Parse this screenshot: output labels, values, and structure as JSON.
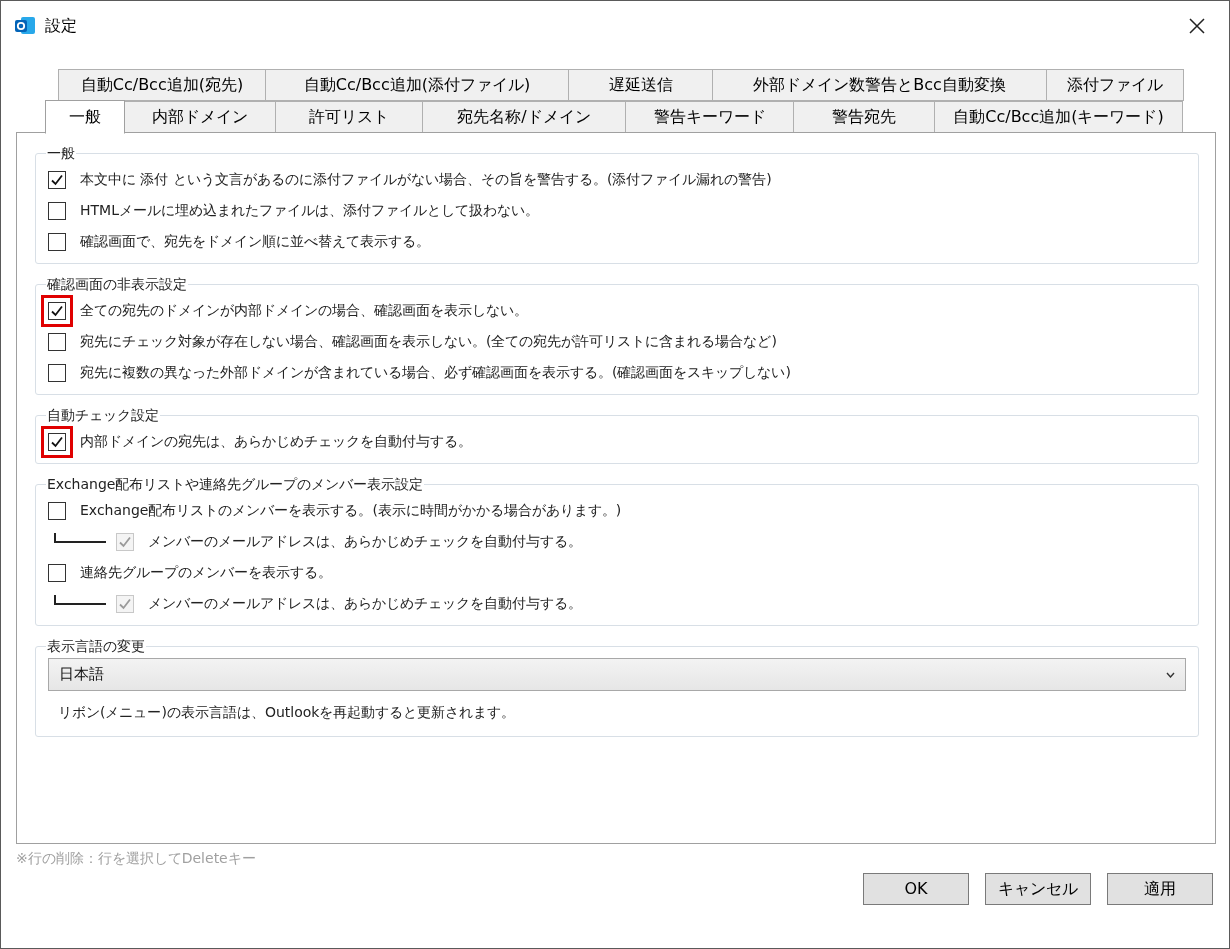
{
  "window": {
    "title": "設定"
  },
  "tab_rows": [
    {
      "tabs": [
        {
          "label": "自動Cc/Bcc追加(宛先)",
          "selected": false
        },
        {
          "label": "自動Cc/Bcc追加(添付ファイル)",
          "selected": false
        },
        {
          "label": "遅延送信",
          "selected": false
        },
        {
          "label": "外部ドメイン数警告とBcc自動変換",
          "selected": false
        },
        {
          "label": "添付ファイル",
          "selected": false
        }
      ]
    },
    {
      "tabs": [
        {
          "label": "一般",
          "selected": true
        },
        {
          "label": "内部ドメイン",
          "selected": false
        },
        {
          "label": "許可リスト",
          "selected": false
        },
        {
          "label": "宛先名称/ドメイン",
          "selected": false
        },
        {
          "label": "警告キーワード",
          "selected": false
        },
        {
          "label": "警告宛先",
          "selected": false
        },
        {
          "label": "自動Cc/Bcc追加(キーワード)",
          "selected": false
        }
      ]
    }
  ],
  "groups": [
    {
      "title": "一般",
      "options": [
        {
          "label": "本文中に 添付 という文言があるのに添付ファイルがない場合、その旨を警告する。(添付ファイル漏れの警告)",
          "checked": true,
          "highlighted": false
        },
        {
          "label": "HTMLメールに埋め込まれたファイルは、添付ファイルとして扱わない。",
          "checked": false,
          "highlighted": false
        },
        {
          "label": "確認画面で、宛先をドメイン順に並べ替えて表示する。",
          "checked": false,
          "highlighted": false
        }
      ]
    },
    {
      "title": "確認画面の非表示設定",
      "options": [
        {
          "label": "全ての宛先のドメインが内部ドメインの場合、確認画面を表示しない。",
          "checked": true,
          "highlighted": true
        },
        {
          "label": "宛先にチェック対象が存在しない場合、確認画面を表示しない。(全ての宛先が許可リストに含まれる場合など)",
          "checked": false,
          "highlighted": false
        },
        {
          "label": "宛先に複数の異なった外部ドメインが含まれている場合、必ず確認画面を表示する。(確認画面をスキップしない)",
          "checked": false,
          "highlighted": false
        }
      ]
    },
    {
      "title": "自動チェック設定",
      "options": [
        {
          "label": "内部ドメインの宛先は、あらかじめチェックを自動付与する。",
          "checked": true,
          "highlighted": true
        }
      ]
    },
    {
      "title": "Exchange配布リストや連絡先グループのメンバー表示設定",
      "options": [
        {
          "label": "Exchange配布リストのメンバーを表示する。(表示に時間がかかる場合があります。)",
          "checked": false,
          "highlighted": false,
          "children": [
            {
              "label": "メンバーのメールアドレスは、あらかじめチェックを自動付与する。",
              "checked": true,
              "disabled": true,
              "highlighted": false
            }
          ]
        },
        {
          "label": "連絡先グループのメンバーを表示する。",
          "checked": false,
          "highlighted": false,
          "children": [
            {
              "label": "メンバーのメールアドレスは、あらかじめチェックを自動付与する。",
              "checked": true,
              "disabled": true,
              "highlighted": false
            }
          ]
        }
      ]
    }
  ],
  "language": {
    "title": "表示言語の変更",
    "value": "日本語",
    "note": "リボン(メニュー)の表示言語は、Outlookを再起動すると更新されます。"
  },
  "hint": "※行の削除：行を選択してDeleteキー",
  "buttons": [
    "OK",
    "キャンセル",
    "適用"
  ]
}
